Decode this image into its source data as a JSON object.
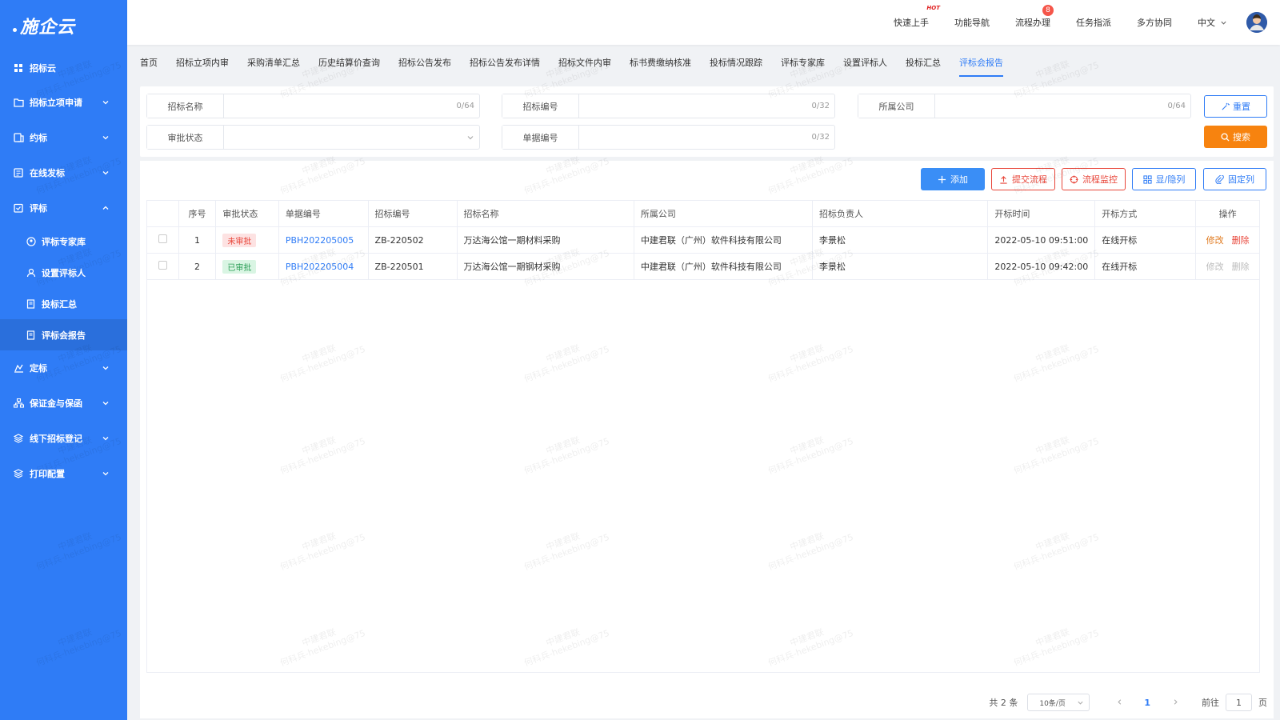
{
  "app": {
    "logo": "施企云"
  },
  "sidebar": {
    "top": {
      "label": "招标云"
    },
    "items": [
      {
        "label": "招标立项申请"
      },
      {
        "label": "约标"
      },
      {
        "label": "在线发标"
      },
      {
        "label": "评标"
      }
    ],
    "sub_items": [
      {
        "label": "评标专家库"
      },
      {
        "label": "设置评标人"
      },
      {
        "label": "投标汇总"
      },
      {
        "label": "评标会报告"
      }
    ],
    "items_after": [
      {
        "label": "定标"
      },
      {
        "label": "保证金与保函"
      },
      {
        "label": "线下招标登记"
      },
      {
        "label": "打印配置"
      }
    ]
  },
  "topbar": {
    "quick_start": "快速上手",
    "hot": "HOT",
    "nav": "功能导航",
    "process": "流程办理",
    "process_count": "8",
    "tasks": "任务指派",
    "collab": "多方协同",
    "lang": "中文"
  },
  "tabs": [
    "首页",
    "招标立项内审",
    "采购清单汇总",
    "历史结算价查询",
    "招标公告发布",
    "招标公告发布详情",
    "招标文件内审",
    "标书费缴纳核准",
    "投标情况跟踪",
    "评标专家库",
    "设置评标人",
    "投标汇总",
    "评标会报告"
  ],
  "filters": {
    "bid_name": {
      "label": "招标名称",
      "count": "0/64"
    },
    "bid_no": {
      "label": "招标编号",
      "count": "0/32"
    },
    "company": {
      "label": "所属公司",
      "count": "0/64"
    },
    "status": {
      "label": "审批状态"
    },
    "doc_no": {
      "label": "单据编号",
      "count": "0/32"
    },
    "reset": "重置",
    "search": "搜索"
  },
  "toolbar": {
    "add": "添加",
    "submit": "提交流程",
    "monitor": "流程监控",
    "columns": "显/隐列",
    "fixed": "固定列"
  },
  "table": {
    "headers": [
      "序号",
      "审批状态",
      "单据编号",
      "招标编号",
      "招标名称",
      "所属公司",
      "招标负责人",
      "开标时间",
      "开标方式",
      "操作"
    ],
    "rows": [
      {
        "idx": "1",
        "status": "未审批",
        "doc_no": "PBH202205005",
        "bid_no": "ZB-220502",
        "name": "万达海公馆一期材料采购",
        "company": "中建君联（广州）软件科技有限公司",
        "owner": "李景松",
        "time": "2022-05-10 09:51:00",
        "mode": "在线开标",
        "edit": "修改",
        "del": "删除"
      },
      {
        "idx": "2",
        "status": "已审批",
        "doc_no": "PBH202205004",
        "bid_no": "ZB-220501",
        "name": "万达海公馆一期钢材采购",
        "company": "中建君联（广州）软件科技有限公司",
        "owner": "李景松",
        "time": "2022-05-10 09:42:00",
        "mode": "在线开标",
        "edit": "修改",
        "del": "删除"
      }
    ]
  },
  "pager": {
    "total": "共 2 条",
    "page_size": "10条/页",
    "page": "1",
    "goto_label": "前往",
    "goto_value": "1",
    "goto_suffix": "页"
  },
  "watermark": {
    "line1": "中建君联",
    "line2": "何科兵-hekebing@75"
  },
  "colors": {
    "primary": "#2f7cf6",
    "search": "#f7830f",
    "danger": "#e8463a"
  }
}
